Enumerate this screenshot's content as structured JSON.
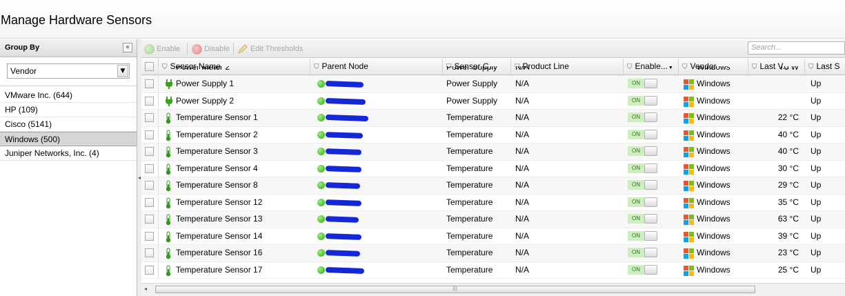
{
  "page": {
    "title": "Manage Hardware Sensors"
  },
  "group_panel": {
    "title": "Group By",
    "collapse_glyph": "«",
    "select_value": "Vendor",
    "groups": [
      {
        "label": "VMware Inc. (644)"
      },
      {
        "label": "HP (109)"
      },
      {
        "label": "Cisco (5141)"
      },
      {
        "label": "Windows (500)",
        "selected": true
      },
      {
        "label": "Juniper Networks, Inc. (4)"
      }
    ]
  },
  "toolbar": {
    "enable_label": "Enable",
    "disable_label": "Disable",
    "edit_thresholds_label": "Edit Thresholds",
    "search_placeholder": "Search..."
  },
  "grid": {
    "columns": [
      "Sensor Name",
      "Parent Node",
      "Sensor C...",
      "Product Line",
      "Enable...",
      "Vendor",
      "Last V...",
      "Last S"
    ],
    "partial_top_row": {
      "name": "Power Meter 2",
      "category": "Power Supply",
      "product_line": "N/A",
      "vendor": "Windows",
      "last_value": "70 W"
    },
    "rows": [
      {
        "name": "Power Supply 1",
        "icon": "plug-icon",
        "category": "Power Supply",
        "product_line": "N/A",
        "enabled": "ON",
        "vendor": "Windows",
        "last_value": "",
        "last_status": "Up"
      },
      {
        "name": "Power Supply 2",
        "icon": "plug-icon",
        "category": "Power Supply",
        "product_line": "N/A",
        "enabled": "ON",
        "vendor": "Windows",
        "last_value": "",
        "last_status": "Up"
      },
      {
        "name": "Temperature Sensor 1",
        "icon": "thermometer-icon",
        "category": "Temperature",
        "product_line": "N/A",
        "enabled": "ON",
        "vendor": "Windows",
        "last_value": "22 °C",
        "last_status": "Up"
      },
      {
        "name": "Temperature Sensor 2",
        "icon": "thermometer-icon",
        "category": "Temperature",
        "product_line": "N/A",
        "enabled": "ON",
        "vendor": "Windows",
        "last_value": "40 °C",
        "last_status": "Up"
      },
      {
        "name": "Temperature Sensor 3",
        "icon": "thermometer-icon",
        "category": "Temperature",
        "product_line": "N/A",
        "enabled": "ON",
        "vendor": "Windows",
        "last_value": "40 °C",
        "last_status": "Up"
      },
      {
        "name": "Temperature Sensor 4",
        "icon": "thermometer-icon",
        "category": "Temperature",
        "product_line": "N/A",
        "enabled": "ON",
        "vendor": "Windows",
        "last_value": "30 °C",
        "last_status": "Up"
      },
      {
        "name": "Temperature Sensor 8",
        "icon": "thermometer-icon",
        "category": "Temperature",
        "product_line": "N/A",
        "enabled": "ON",
        "vendor": "Windows",
        "last_value": "29 °C",
        "last_status": "Up"
      },
      {
        "name": "Temperature Sensor 12",
        "icon": "thermometer-icon",
        "category": "Temperature",
        "product_line": "N/A",
        "enabled": "ON",
        "vendor": "Windows",
        "last_value": "35 °C",
        "last_status": "Up"
      },
      {
        "name": "Temperature Sensor 13",
        "icon": "thermometer-icon",
        "category": "Temperature",
        "product_line": "N/A",
        "enabled": "ON",
        "vendor": "Windows",
        "last_value": "63 °C",
        "last_status": "Up"
      },
      {
        "name": "Temperature Sensor 14",
        "icon": "thermometer-icon",
        "category": "Temperature",
        "product_line": "N/A",
        "enabled": "ON",
        "vendor": "Windows",
        "last_value": "39 °C",
        "last_status": "Up"
      },
      {
        "name": "Temperature Sensor 16",
        "icon": "thermometer-icon",
        "category": "Temperature",
        "product_line": "N/A",
        "enabled": "ON",
        "vendor": "Windows",
        "last_value": "23 °C",
        "last_status": "Up"
      },
      {
        "name": "Temperature Sensor 17",
        "icon": "thermometer-icon",
        "category": "Temperature",
        "product_line": "N/A",
        "enabled": "ON",
        "vendor": "Windows",
        "last_value": "25 °C",
        "last_status": "Up"
      }
    ]
  },
  "colors": {
    "status_up": "#2aa51a",
    "toggle_on": "#cfeec0",
    "redaction": "#1428d8"
  }
}
